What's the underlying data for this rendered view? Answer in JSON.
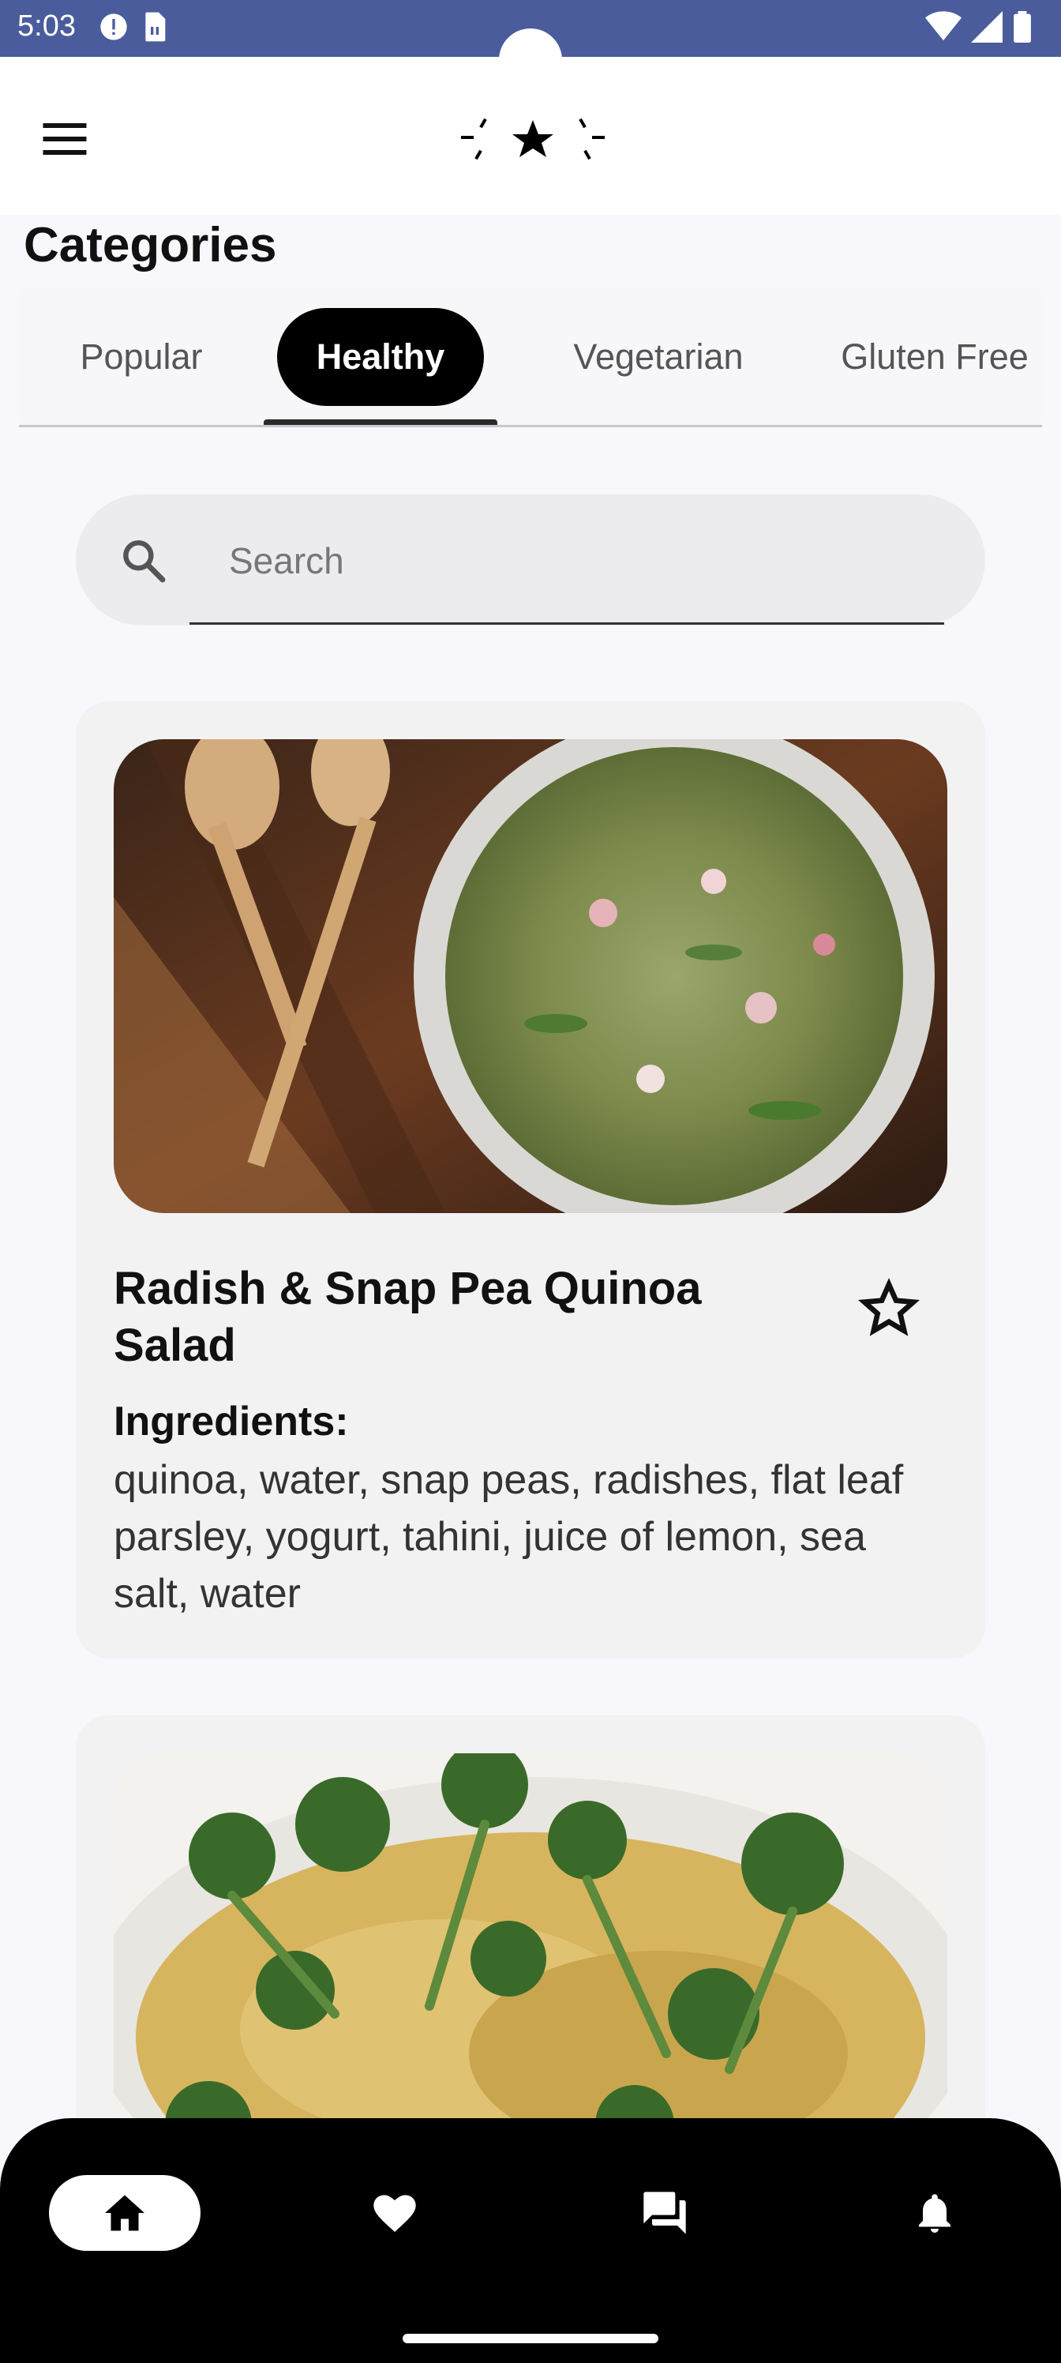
{
  "status_bar": {
    "time": "5:03"
  },
  "app_bar": {
    "menu_icon": "menu-icon",
    "logo_icon": "star-logo"
  },
  "page": {
    "title": "Categories"
  },
  "tabs": [
    {
      "label": "Popular",
      "active": false
    },
    {
      "label": "Healthy",
      "active": true
    },
    {
      "label": "Vegetarian",
      "active": false
    },
    {
      "label": "Gluten Free",
      "active": false
    }
  ],
  "search": {
    "placeholder": "Search",
    "value": ""
  },
  "recipes": [
    {
      "title": "Radish & Snap Pea Quinoa Salad",
      "ingredients_label": "Ingredients:",
      "ingredients": "quinoa, water, snap peas, radishes, flat leaf parsley, yogurt, tahini, juice of lemon, sea salt, water",
      "favorite": false
    }
  ],
  "bottom_nav": [
    {
      "icon": "home-icon",
      "active": true
    },
    {
      "icon": "heart-icon",
      "active": false
    },
    {
      "icon": "chat-icon",
      "active": false
    },
    {
      "icon": "bell-icon",
      "active": false
    }
  ],
  "colors": {
    "status_bar": "#4a5c9c",
    "accent": "#000000",
    "surface": "#f2f2f3"
  }
}
